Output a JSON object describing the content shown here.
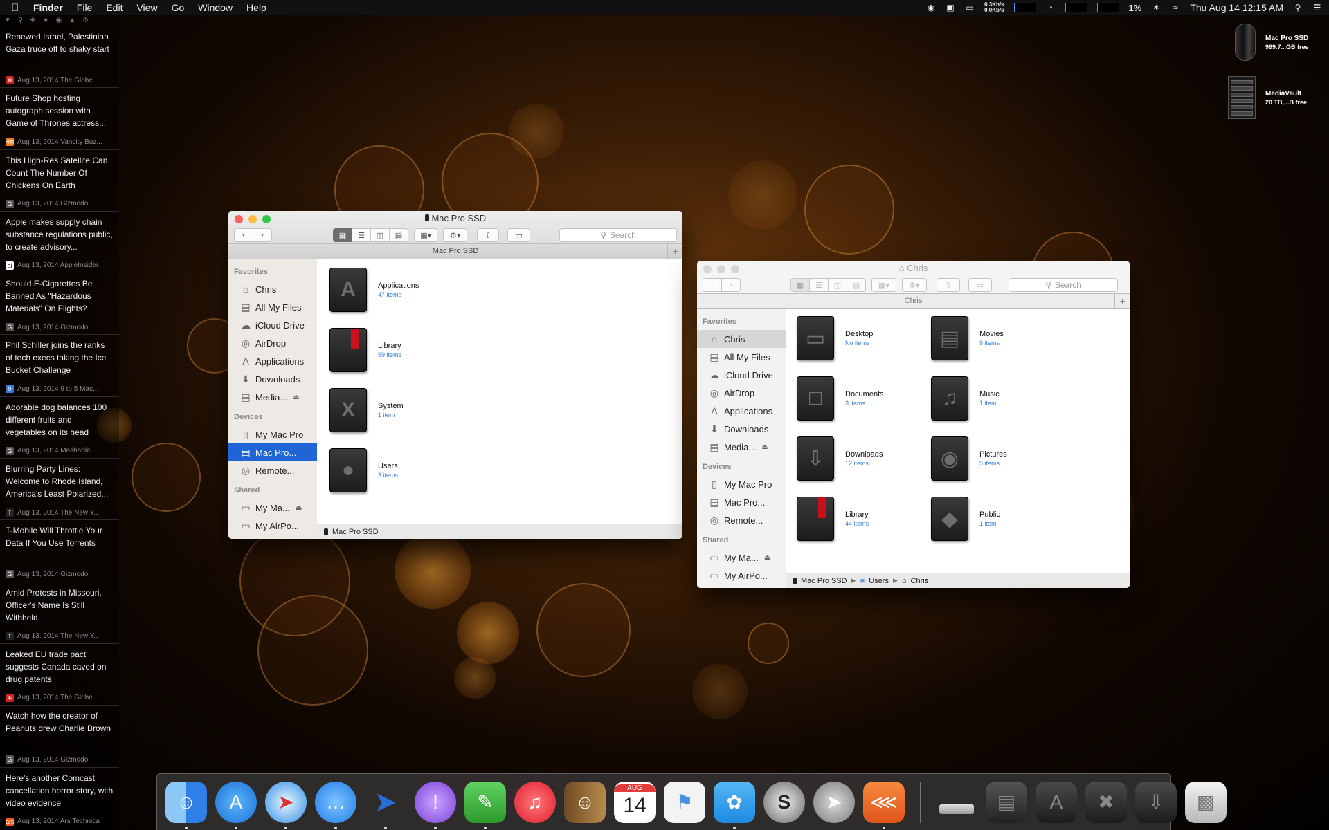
{
  "menubar": {
    "app_name": "Finder",
    "menus": [
      "File",
      "Edit",
      "View",
      "Go",
      "Window",
      "Help"
    ],
    "net_up": "0.3Kb/s",
    "net_down": "0.0Kb/s",
    "cpu": "1%",
    "clock": "Thu Aug 14  12:15 AM"
  },
  "news": [
    {
      "title": "Renewed Israel, Palestinian Gaza truce off to shaky start",
      "meta": "Aug 13, 2014 The Globe...",
      "icon": "maple-leaf-icon",
      "color": "#d42020"
    },
    {
      "title": "Future Shop hosting autograph session with Game of Thrones actress...",
      "meta": "Aug 13, 2014 Vancity Buz...",
      "icon": "rss-icon",
      "color": "#f07a20"
    },
    {
      "title": "This High-Res Satellite Can Count The Number Of Chickens On Earth",
      "meta": "Aug 13, 2014 Gizmodo",
      "icon": "g-icon",
      "color": "#555555"
    },
    {
      "title": "Apple makes supply chain substance regulations public, to create advisory...",
      "meta": "Aug 13, 2014 AppleInsider",
      "icon": "ai-icon",
      "color": "#ffffff"
    },
    {
      "title": "Should E-Cigarettes Be Banned As \"Hazardous Materials\" On Flights?",
      "meta": "Aug 13, 2014 Gizmodo",
      "icon": "g-icon",
      "color": "#555555"
    },
    {
      "title": "Phil Schiller joins the ranks of tech execs taking the Ice Bucket Challenge",
      "meta": "Aug 13, 2014 9 to 5 Mac...",
      "icon": "nine-to-five-icon",
      "color": "#3a7bd5"
    },
    {
      "title": "Adorable dog balances 100 different fruits and vegetables on its head",
      "meta": "Aug 13, 2014 Mashable",
      "icon": "g-icon",
      "color": "#555555"
    },
    {
      "title": "Blurring Party Lines: Welcome to Rhode Island, America's Least Polarized...",
      "meta": "Aug 13, 2014 The New Y...",
      "icon": "nyt-icon",
      "color": "#222222"
    },
    {
      "title": "T-Mobile Will Throttle Your Data If You Use Torrents",
      "meta": "Aug 13, 2014 Gizmodo",
      "icon": "g-icon",
      "color": "#555555"
    },
    {
      "title": "Amid Protests in Missouri, Officer's Name Is Still Withheld",
      "meta": "Aug 13, 2014 The New Y...",
      "icon": "nyt-icon",
      "color": "#222222"
    },
    {
      "title": "Leaked EU trade pact suggests Canada caved on drug patents",
      "meta": "Aug 13, 2014 The Globe...",
      "icon": "maple-leaf-icon",
      "color": "#d42020"
    },
    {
      "title": "Watch how the creator of Peanuts drew Charlie Brown",
      "meta": "Aug 13, 2014 Gizmodo",
      "icon": "g-icon",
      "color": "#555555"
    },
    {
      "title": "Here's another Comcast cancellation horror story, with video evidence",
      "meta": "Aug 13, 2014 Ars Technica",
      "icon": "ars-icon",
      "color": "#f05a22"
    }
  ],
  "drives": [
    {
      "name": "Mac Pro SSD",
      "info": "999.7...GB free"
    },
    {
      "name": "MediaVault",
      "info": "20 TB,...B free"
    }
  ],
  "sidebar": {
    "favorites_head": "Favorites",
    "favorites": [
      "Chris",
      "All My Files",
      "iCloud Drive",
      "AirDrop",
      "Applications",
      "Downloads",
      "Media..."
    ],
    "devices_head": "Devices",
    "devices": [
      "My Mac Pro",
      "Mac Pro...",
      "Remote..."
    ],
    "shared_head": "Shared",
    "shared": [
      "My Ma...",
      "My AirPo..."
    ]
  },
  "win1": {
    "title": "Mac Pro SSD",
    "tab": "Mac Pro SSD",
    "search_placeholder": "Search",
    "items": [
      {
        "name": "Applications",
        "count": "47 items"
      },
      {
        "name": "Library",
        "count": "59 items"
      },
      {
        "name": "System",
        "count": "1 item"
      },
      {
        "name": "Users",
        "count": "3 items"
      }
    ],
    "status": "Mac Pro SSD"
  },
  "win2": {
    "title": "Chris",
    "tab": "Chris",
    "search_placeholder": "Search",
    "items": [
      {
        "name": "Desktop",
        "count": "No items"
      },
      {
        "name": "Movies",
        "count": "9 items"
      },
      {
        "name": "Documents",
        "count": "3 items"
      },
      {
        "name": "Music",
        "count": "1 item"
      },
      {
        "name": "Downloads",
        "count": "12 items"
      },
      {
        "name": "Pictures",
        "count": "5 items"
      },
      {
        "name": "Library",
        "count": "44 items"
      },
      {
        "name": "Public",
        "count": "1 item"
      }
    ],
    "path": [
      "Mac Pro SSD",
      "Users",
      "Chris"
    ]
  },
  "dock": {
    "calendar_month": "AUG",
    "calendar_day": "14"
  }
}
